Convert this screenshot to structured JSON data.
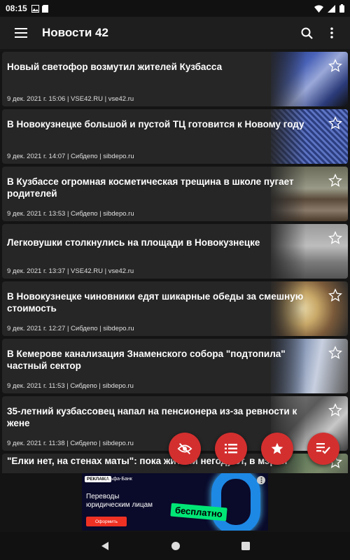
{
  "status_bar": {
    "time": "08:15"
  },
  "app_bar": {
    "title": "Новости 42"
  },
  "articles": [
    {
      "title": "Новый светофор возмутил жителей Кузбасса",
      "meta": "9 дек. 2021 г. 15:06   | VSE42.RU | vse42.ru"
    },
    {
      "title": "В Новокузнецке большой и пустой ТЦ готовится к Новому году",
      "meta": "9 дек. 2021 г. 14:07   | Сибдепо | sibdepo.ru"
    },
    {
      "title": "В Кузбассе огромная косметическая трещина в школе пугает родителей",
      "meta": "9 дек. 2021 г. 13:53   | Сибдепо | sibdepo.ru"
    },
    {
      "title": "Легковушки столкнулись на площади в Новокузнецке",
      "meta": "9 дек. 2021 г. 13:37   | VSE42.RU | vse42.ru"
    },
    {
      "title": "В Новокузнецке чиновники едят шикарные обеды за смешную стоимость",
      "meta": "9 дек. 2021 г. 12:27   | Сибдепо | sibdepo.ru"
    },
    {
      "title": "В Кемерове канализация Знаменского собора \"подтопила\" частный сектор",
      "meta": "9 дек. 2021 г. 11:53   | Сибдепо | sibdepo.ru"
    },
    {
      "title": "35-летний кузбассовец напал на пенсионера из-за ревности к жене",
      "meta": "9 дек. 2021 г. 11:38   | Сибдепо | sibdepo.ru"
    },
    {
      "title": "\"Елки нет, на стенах маты\": пока жители негодуют, в мэрии",
      "meta": ""
    }
  ],
  "ad": {
    "label": "РЕКЛАМА",
    "bank": "Альфа-Банк",
    "text": "Переводы юридическим лицам",
    "free": "бесплатно",
    "button": "Оформить"
  },
  "colors": {
    "accent": "#d32f2f",
    "background": "#161616",
    "card": "#262626"
  }
}
